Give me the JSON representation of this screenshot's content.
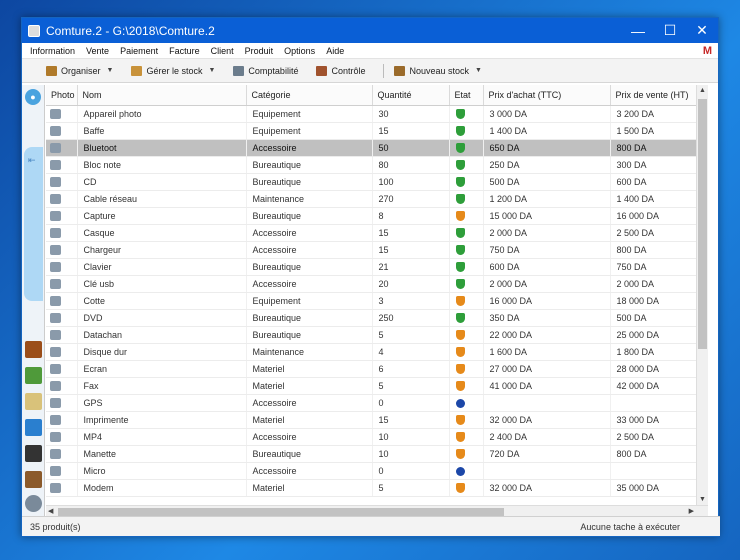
{
  "window": {
    "title": "Comture.2 - G:\\2018\\Comture.2",
    "minimize": "—",
    "maximize": "☐",
    "close": "✕"
  },
  "menu": [
    "Information",
    "Vente",
    "Paiement",
    "Facture",
    "Client",
    "Produit",
    "Options",
    "Aide"
  ],
  "gmail_icon": "M",
  "toolbar": {
    "organiser": "Organiser",
    "gerer_stock": "Gérer le stock",
    "comptabilite": "Comptabilité",
    "controle": "Contrôle",
    "nouveau_stock": "Nouveau stock"
  },
  "columns": [
    "Photo",
    "Nom",
    "Catégorie",
    "Quantité",
    "Etat",
    "Prix d'achat (TTC)",
    "Prix de vente (HT)"
  ],
  "rows": [
    {
      "nom": "Appareil photo",
      "categorie": "Equipement",
      "quantite": "30",
      "etat": "ok",
      "achat": "3 000 DA",
      "vente": "3 200 DA"
    },
    {
      "nom": "Baffe",
      "categorie": "Equipement",
      "quantite": "15",
      "etat": "ok",
      "achat": "1 400 DA",
      "vente": "1 500 DA"
    },
    {
      "nom": "Bluetoot",
      "categorie": "Accessoire",
      "quantite": "50",
      "etat": "ok",
      "achat": "650 DA",
      "vente": "800 DA"
    },
    {
      "nom": "Bloc note",
      "categorie": "Bureautique",
      "quantite": "80",
      "etat": "ok",
      "achat": "250 DA",
      "vente": "300 DA"
    },
    {
      "nom": "CD",
      "categorie": "Bureautique",
      "quantite": "100",
      "etat": "ok",
      "achat": "500 DA",
      "vente": "600 DA"
    },
    {
      "nom": "Cable réseau",
      "categorie": "Maintenance",
      "quantite": "270",
      "etat": "ok",
      "achat": "1 200 DA",
      "vente": "1 400 DA"
    },
    {
      "nom": "Capture",
      "categorie": "Bureautique",
      "quantite": "8",
      "etat": "warn",
      "achat": "15 000 DA",
      "vente": "16 000 DA"
    },
    {
      "nom": "Casque",
      "categorie": "Accessoire",
      "quantite": "15",
      "etat": "ok",
      "achat": "2 000 DA",
      "vente": "2 500 DA"
    },
    {
      "nom": "Chargeur",
      "categorie": "Accessoire",
      "quantite": "15",
      "etat": "ok",
      "achat": "750 DA",
      "vente": "800 DA"
    },
    {
      "nom": "Clavier",
      "categorie": "Bureautique",
      "quantite": "21",
      "etat": "ok",
      "achat": "600 DA",
      "vente": "750 DA"
    },
    {
      "nom": "Clé usb",
      "categorie": "Accessoire",
      "quantite": "20",
      "etat": "ok",
      "achat": "2 000 DA",
      "vente": "2 000 DA"
    },
    {
      "nom": "Cotte",
      "categorie": "Equipement",
      "quantite": "3",
      "etat": "warn",
      "achat": "16 000 DA",
      "vente": "18 000 DA"
    },
    {
      "nom": "DVD",
      "categorie": "Bureautique",
      "quantite": "250",
      "etat": "ok",
      "achat": "350 DA",
      "vente": "500 DA"
    },
    {
      "nom": "Datachan",
      "categorie": "Bureautique",
      "quantite": "5",
      "etat": "warn",
      "achat": "22 000 DA",
      "vente": "25 000 DA"
    },
    {
      "nom": "Disque dur",
      "categorie": "Maintenance",
      "quantite": "4",
      "etat": "warn",
      "achat": "1 600 DA",
      "vente": "1 800 DA"
    },
    {
      "nom": "Ecran",
      "categorie": "Materiel",
      "quantite": "6",
      "etat": "warn",
      "achat": "27 000 DA",
      "vente": "28 000 DA"
    },
    {
      "nom": "Fax",
      "categorie": "Materiel",
      "quantite": "5",
      "etat": "warn",
      "achat": "41 000 DA",
      "vente": "42 000 DA"
    },
    {
      "nom": "GPS",
      "categorie": "Accessoire",
      "quantite": "0",
      "etat": "q",
      "achat": "",
      "vente": ""
    },
    {
      "nom": "Imprimente",
      "categorie": "Materiel",
      "quantite": "15",
      "etat": "warn",
      "achat": "32 000 DA",
      "vente": "33 000 DA"
    },
    {
      "nom": "MP4",
      "categorie": "Accessoire",
      "quantite": "10",
      "etat": "warn",
      "achat": "2 400 DA",
      "vente": "2 500 DA"
    },
    {
      "nom": "Manette",
      "categorie": "Bureautique",
      "quantite": "10",
      "etat": "warn",
      "achat": "720 DA",
      "vente": "800 DA"
    },
    {
      "nom": "Micro",
      "categorie": "Accessoire",
      "quantite": "0",
      "etat": "q",
      "achat": "",
      "vente": ""
    },
    {
      "nom": "Modem",
      "categorie": "Materiel",
      "quantite": "5",
      "etat": "warn",
      "achat": "32 000 DA",
      "vente": "35 000 DA"
    }
  ],
  "selected_row": 2,
  "status": {
    "left": "35 produit(s)",
    "right": "Aucune tache à exécuter"
  },
  "colors": {
    "titlebar": "#0a5fd6",
    "selection": "#c0c0c0",
    "ok": "#2e9e3a",
    "warn": "#e68a1a",
    "unknown": "#1c47a8"
  }
}
